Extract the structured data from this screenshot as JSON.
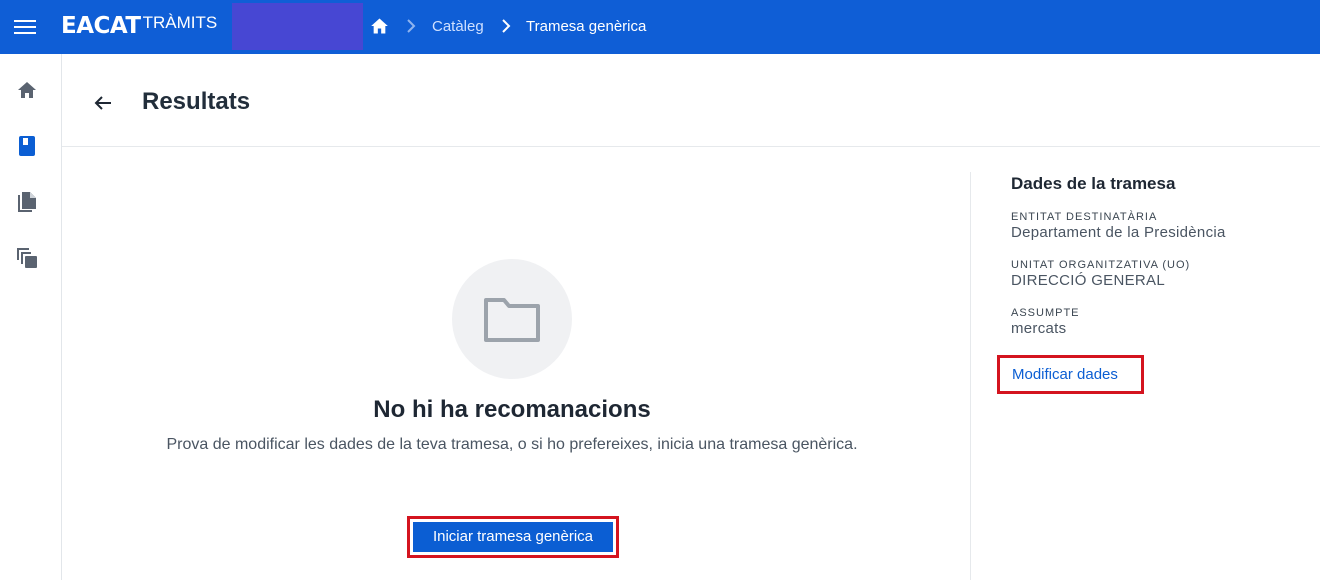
{
  "topbar": {
    "logo_main": "EACAT",
    "logo_sub": "TRÀMITS",
    "breadcrumbs": [
      "Catàleg",
      "Tramesa genèrica"
    ],
    "colors": {
      "bar": "#0f5ed6",
      "redaction": "#4747d3"
    }
  },
  "sidebar": {
    "items": [
      {
        "icon": "home-icon"
      },
      {
        "icon": "book-icon"
      },
      {
        "icon": "documents-icon"
      },
      {
        "icon": "copy-icon"
      }
    ]
  },
  "page": {
    "title": "Resultats"
  },
  "empty_state": {
    "icon": "folder-icon",
    "title": "No hi ha recomanacions",
    "text": "Prova de modificar les dades de la teva tramesa, o si ho prefereixes, inicia una tramesa genèrica.",
    "button_label": "Iniciar tramesa genèrica"
  },
  "details": {
    "title": "Dades de la tramesa",
    "fields": [
      {
        "label": "ENTITAT DESTINATÀRIA",
        "value": "Departament de la Presidència"
      },
      {
        "label": "UNITAT ORGANITZATIVA (UO)",
        "value": "DIRECCIÓ GENERAL"
      },
      {
        "label": "ASSUMPTE",
        "value": "mercats"
      }
    ],
    "link_label": "Modificar dades"
  },
  "colors": {
    "primary": "#0b5ed3",
    "highlight": "#d4141f"
  }
}
